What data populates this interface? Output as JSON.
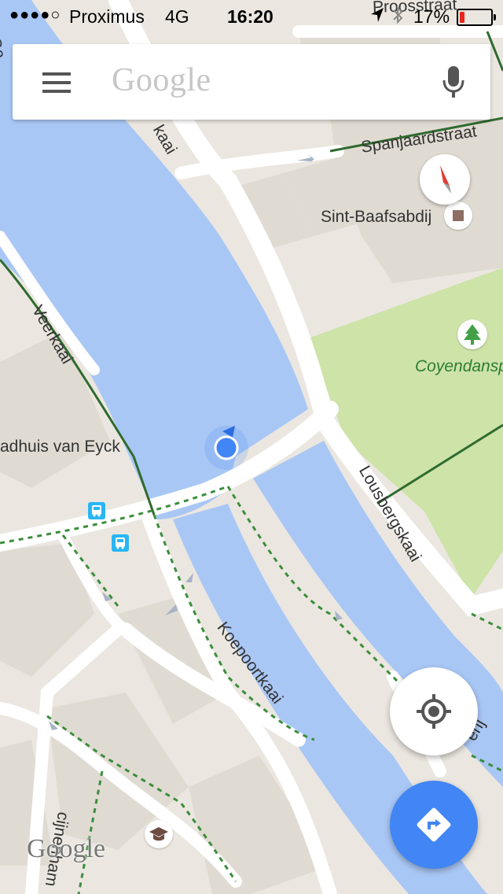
{
  "status_bar": {
    "signal": "●●●●○",
    "carrier": "Proximus",
    "network": "4G",
    "time": "16:20",
    "battery": "17%",
    "battery_level": 0.17,
    "battery_color": "#e5261f"
  },
  "search": {
    "placeholder_logo": "Google",
    "menu_icon": "hamburger-menu-icon",
    "voice_icon": "microphone-icon"
  },
  "map": {
    "water_color": "#a9c7f5",
    "land_color": "#ebe7e0",
    "park_color": "#cde3a8",
    "street_labels": {
      "proostraat": "Proosstraat",
      "spanjaardstraat": "Spanjaardstraat",
      "kaai_top": "kaai",
      "veerkaai": "Veerkaai",
      "lousbergskaai": "Lousbergskaai",
      "koepoortkaai": "Koepoortkaai",
      "ga_fragment": "Ga",
      "erij_fragment": "erij",
      "cijnenham": "cijnenham"
    },
    "poi_labels": {
      "sint_baafsabdij": "Sint-Baafsabdij",
      "coyendanspark": "Coyendansp",
      "hadhuis_van_eyck": "adhuis van Eyck"
    },
    "icons": {
      "abbey": "landmark-icon",
      "park": "tree-icon",
      "bus_stop_1": "bus-icon",
      "bus_stop_2": "bus-icon",
      "school": "school-icon"
    },
    "watermark": "Google"
  },
  "controls": {
    "compass": "compass-icon",
    "my_location": "my-location-icon",
    "directions": "directions-icon",
    "accent": "#4285f4"
  }
}
